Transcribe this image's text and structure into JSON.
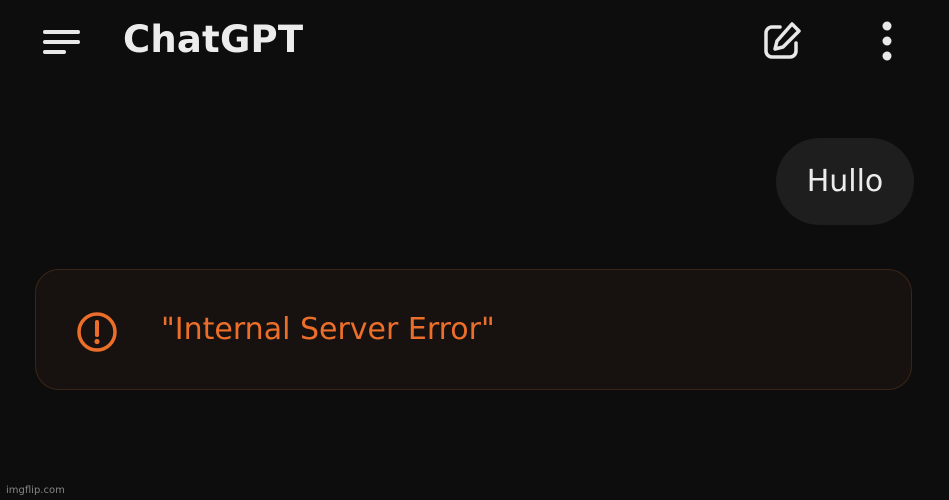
{
  "header": {
    "title": "ChatGPT",
    "menu_icon": "menu-lines-icon",
    "new_chat_icon": "edit-square-icon",
    "more_icon": "more-vertical-icon"
  },
  "conversation": {
    "user_message": "Hullo",
    "error": {
      "icon": "alert-circle-icon",
      "text": "\"Internal Server Error\""
    }
  },
  "watermark": "imgflip.com",
  "colors": {
    "background": "#0d0d0d",
    "text_primary": "#ececec",
    "user_bubble": "#1e1e1e",
    "error_accent": "#ec6e2b",
    "error_background": "#17120f",
    "error_border": "#3a2518"
  }
}
